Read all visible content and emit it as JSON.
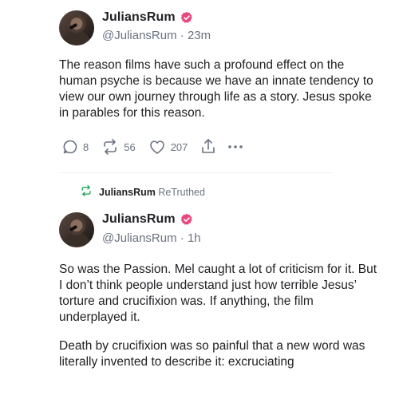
{
  "colors": {
    "verified_badge": "#e8467c",
    "retruth_icon": "#23a65a",
    "muted_text": "#6b7280",
    "primary_text": "#202124"
  },
  "post1": {
    "display_name": "JuliansRum",
    "handle": "@JuliansRum",
    "separator": "·",
    "time": "23m",
    "body": "The reason films have such a profound effect on the human psyche is because we have an innate tendency to view our own journey through life as a story. Jesus spoke in parables for this reason.",
    "actions": {
      "reply_count": "8",
      "retruth_count": "56",
      "like_count": "207"
    },
    "icons": [
      "reply-icon",
      "retruth-icon",
      "like-icon",
      "share-icon",
      "more-icon"
    ]
  },
  "retruth_banner": {
    "name": "JuliansRum",
    "label": "ReTruthed"
  },
  "post2": {
    "display_name": "JuliansRum",
    "handle": "@JuliansRum",
    "separator": "·",
    "time": "1h",
    "paragraphs": [
      "So was the Passion. Mel caught a lot of criticism for it. But I don’t think people understand just how terrible Jesus’ torture and crucifixion was. If anything, the film underplayed it.",
      "Death by crucifixion was so painful that a new word was literally invented to describe it: excruciating"
    ]
  }
}
